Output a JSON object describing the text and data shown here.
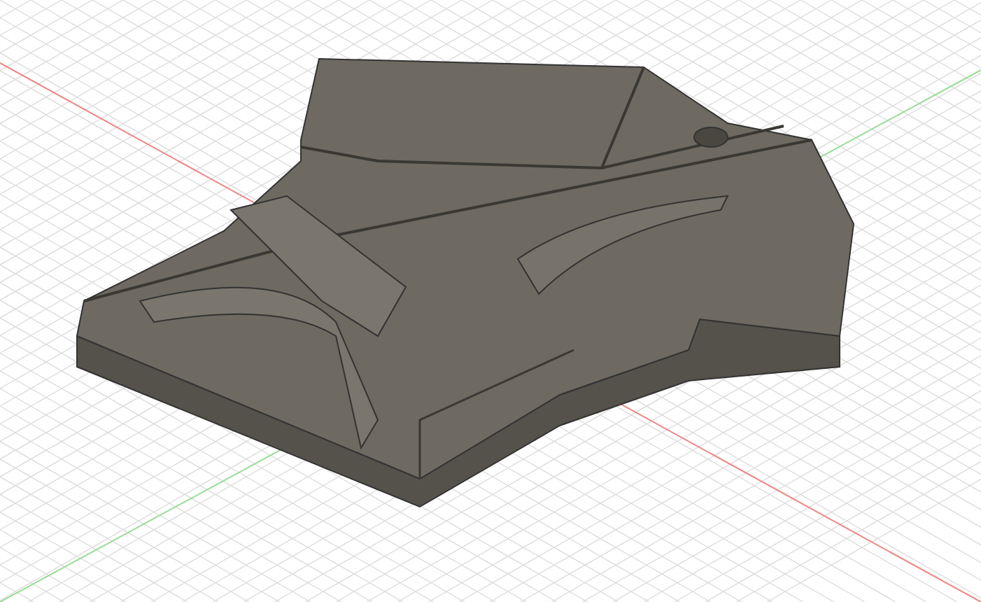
{
  "viewport": {
    "show_grid": true
  }
}
